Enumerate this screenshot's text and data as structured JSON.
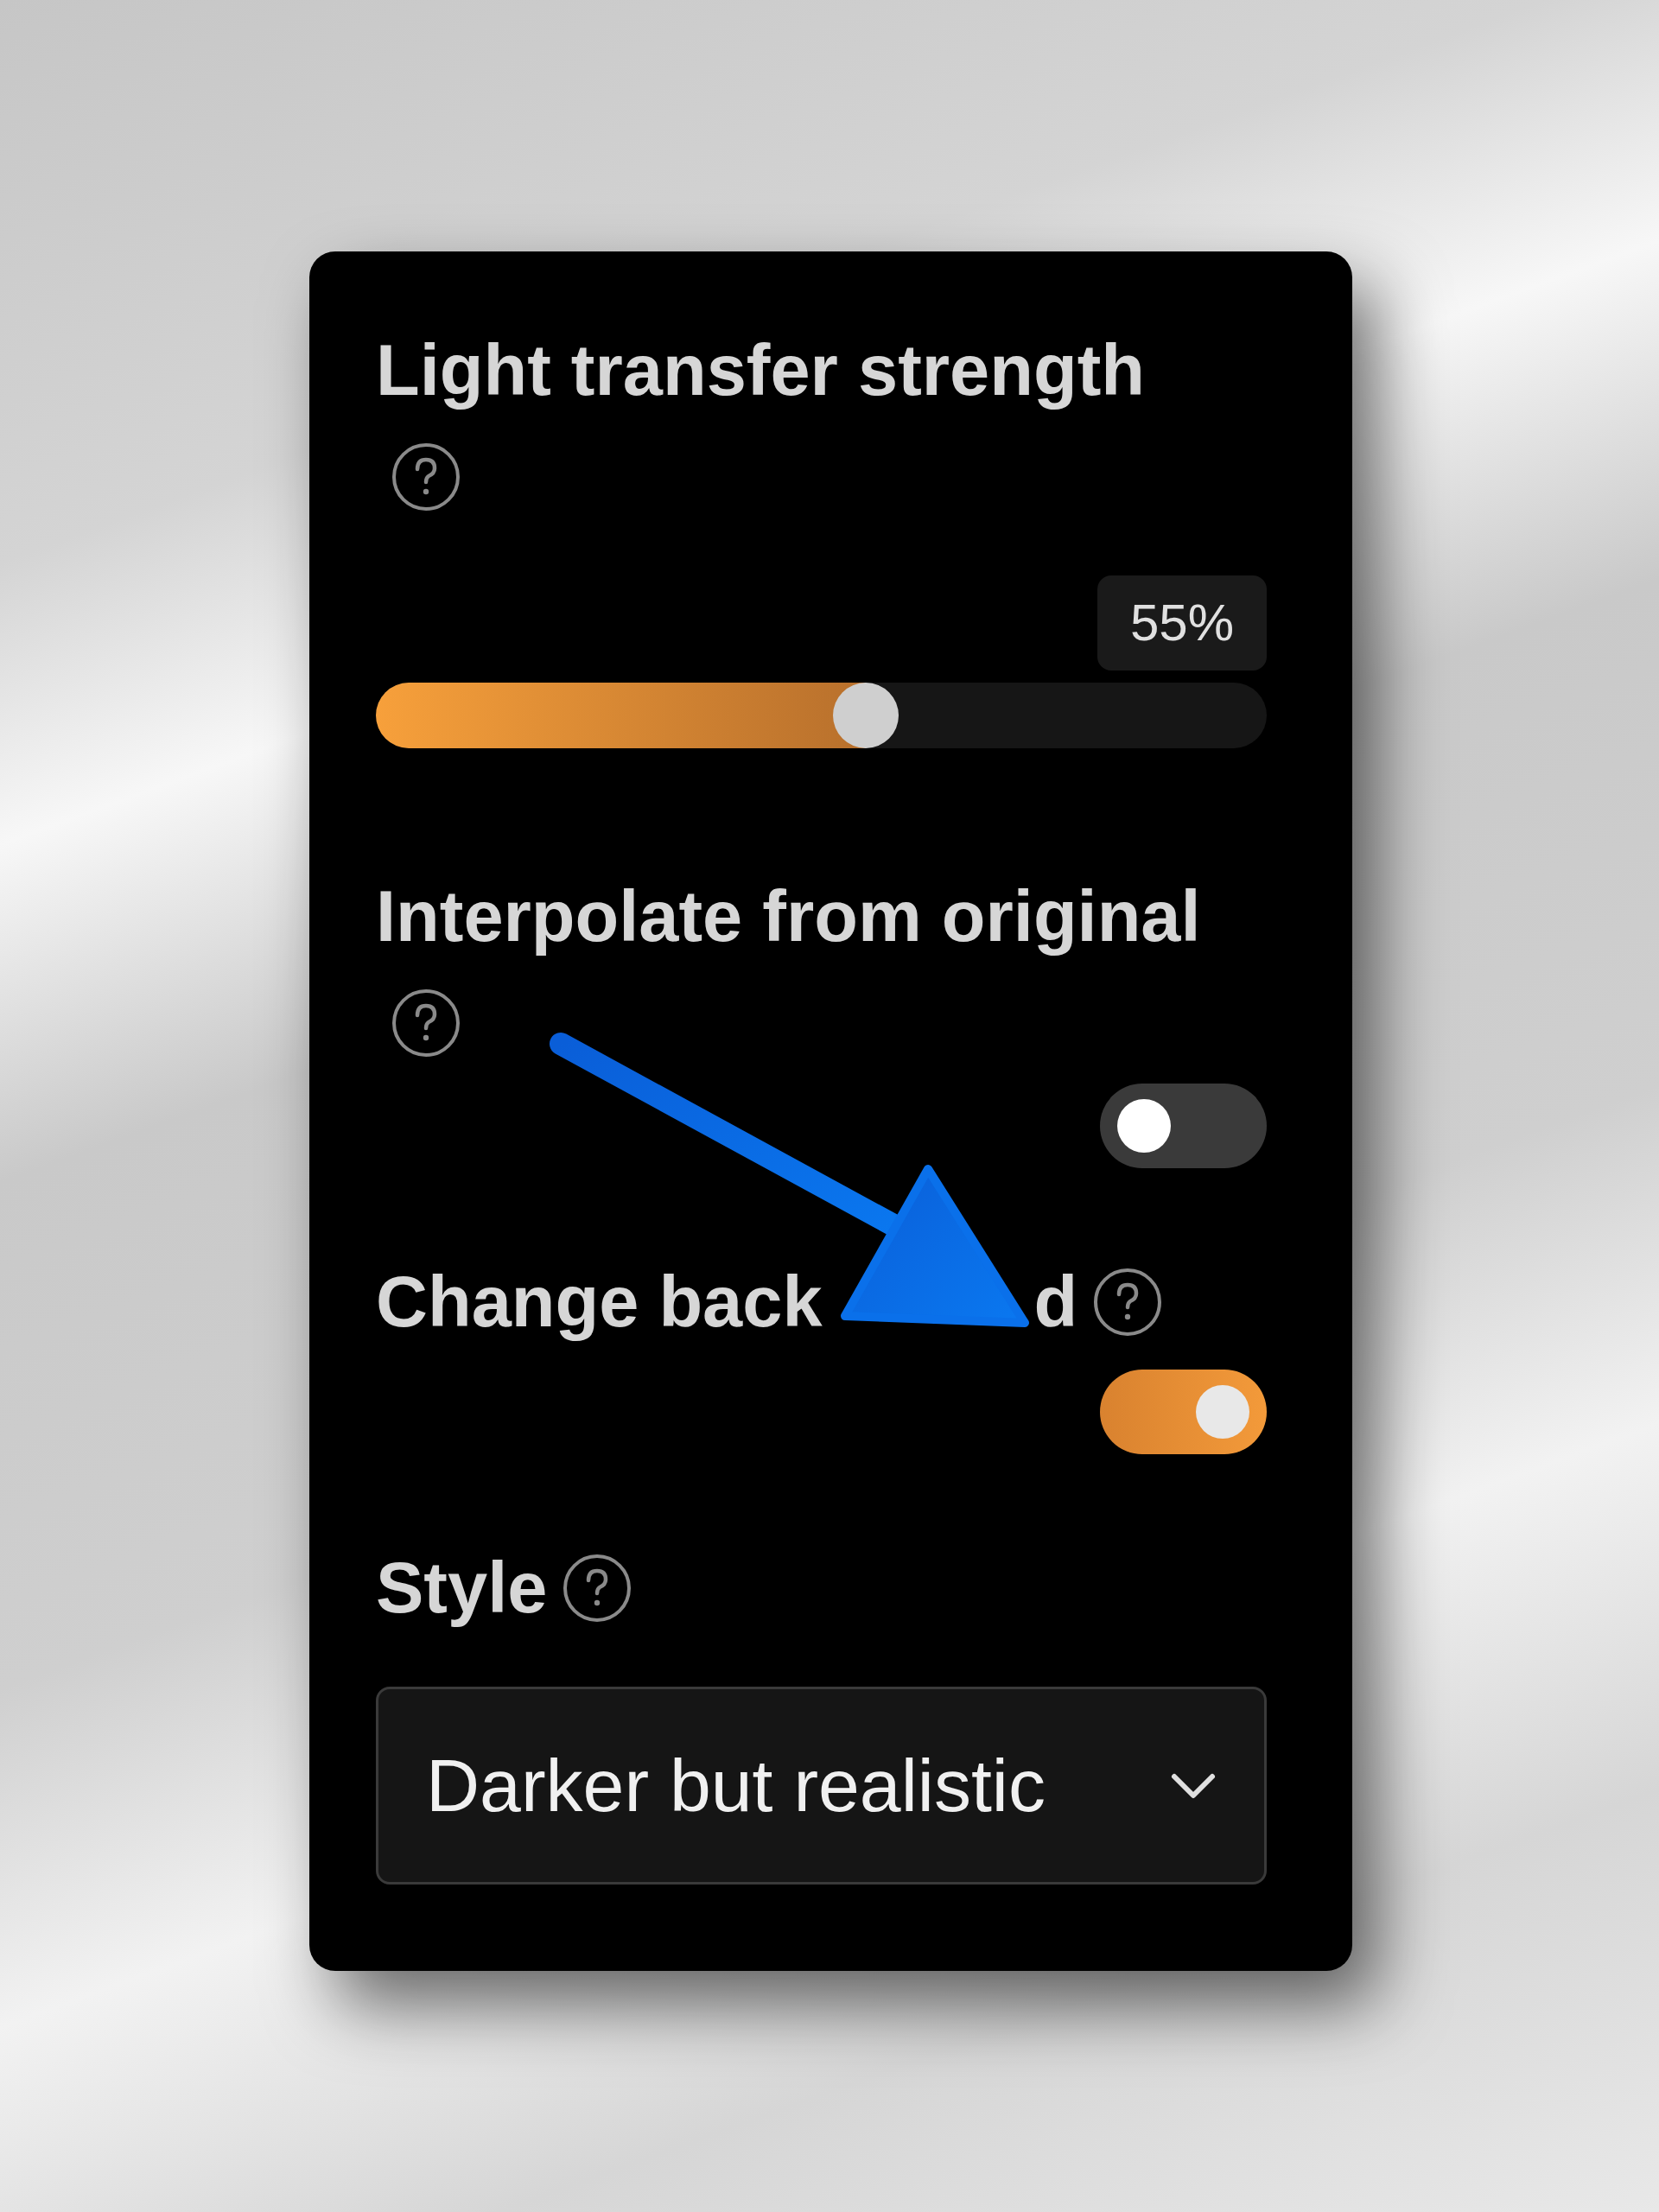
{
  "settings": [
    {
      "kind": "slider",
      "label": "Light transfer strength",
      "value": "55%",
      "level": 0.55
    },
    {
      "kind": "toggle",
      "label": "Interpolate from original",
      "on": false
    },
    {
      "kind": "toggle",
      "label": "Change back",
      "label_tail": "d",
      "on": true
    },
    {
      "kind": "select",
      "label": "Style",
      "value": "Darker but realistic"
    }
  ]
}
